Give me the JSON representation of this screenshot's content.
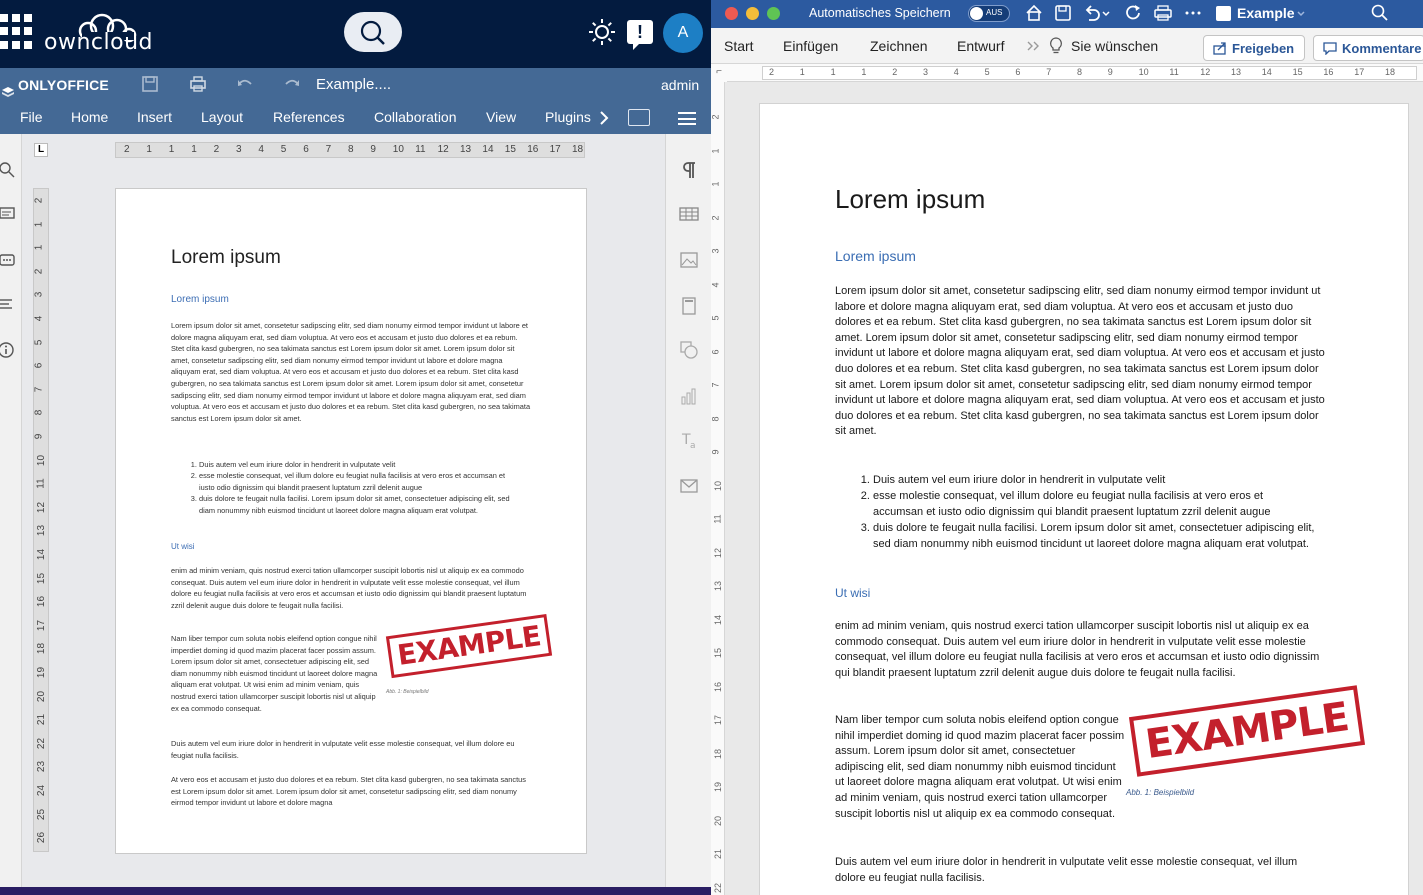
{
  "owncloud": {
    "logo_text": "owncloud",
    "avatar_initial": "A"
  },
  "onlyoffice": {
    "brand": "ONLYOFFICE",
    "doc_title": "Example....",
    "user": "admin",
    "menu": [
      "File",
      "Home",
      "Insert",
      "Layout",
      "References",
      "Collaboration",
      "View",
      "Plugins"
    ],
    "ruler_h": [
      "2",
      "1",
      "1",
      "1",
      "2",
      "3",
      "4",
      "5",
      "6",
      "7",
      "8",
      "9",
      "10",
      "11",
      "12",
      "13",
      "14",
      "15",
      "16",
      "17",
      "18"
    ],
    "ruler_v": [
      "2",
      "1",
      "1",
      "2",
      "3",
      "4",
      "5",
      "6",
      "7",
      "8",
      "9",
      "10",
      "11",
      "12",
      "13",
      "14",
      "15",
      "16",
      "17",
      "18",
      "19",
      "20",
      "21",
      "22",
      "23",
      "24",
      "25",
      "26"
    ],
    "ruler_corner": "L",
    "caption": "Abb. 1: Beispielbild"
  },
  "word": {
    "autosave_label": "Automatisches Speichern",
    "autosave_state": "AUS",
    "doc_name": "Example",
    "tabs": [
      "Start",
      "Einfügen",
      "Zeichnen",
      "Entwurf"
    ],
    "tell_me": "Sie wünschen",
    "share_label": "Freigeben",
    "comments_label": "Kommentare",
    "ruler_h": [
      "2",
      "1",
      "1",
      "1",
      "2",
      "3",
      "4",
      "5",
      "6",
      "7",
      "8",
      "9",
      "10",
      "11",
      "12",
      "13",
      "14",
      "15",
      "16",
      "17",
      "18"
    ],
    "ruler_v": [
      "2",
      "1",
      "1",
      "2",
      "3",
      "4",
      "5",
      "6",
      "7",
      "8",
      "9",
      "10",
      "11",
      "12",
      "13",
      "14",
      "15",
      "16",
      "17",
      "18",
      "19",
      "20",
      "21",
      "22",
      "23"
    ],
    "caption": "Abb. 1: Beispielbild"
  },
  "document": {
    "title": "Lorem ipsum",
    "heading1": "Lorem ipsum",
    "para1": "Lorem ipsum dolor sit amet, consetetur sadipscing elitr, sed diam nonumy eirmod tempor invidunt ut labore et dolore magna aliquyam erat, sed diam voluptua. At vero eos et accusam et justo duo dolores et ea rebum. Stet clita kasd gubergren, no sea takimata sanctus est Lorem ipsum dolor sit amet. Lorem ipsum dolor sit amet, consetetur sadipscing elitr, sed diam nonumy eirmod tempor invidunt ut labore et dolore magna aliquyam erat, sed diam voluptua. At vero eos et accusam et justo duo dolores et ea rebum. Stet clita kasd gubergren, no sea takimata sanctus est Lorem ipsum dolor sit amet. Lorem ipsum dolor sit amet, consetetur sadipscing elitr, sed diam nonumy eirmod tempor invidunt ut labore et dolore magna aliquyam erat, sed diam voluptua. At vero eos et accusam et justo duo dolores et ea rebum. Stet clita kasd gubergren, no sea takimata sanctus est Lorem ipsum dolor sit amet.",
    "list": [
      "Duis autem vel eum iriure dolor in hendrerit in vulputate velit",
      "esse molestie consequat, vel illum dolore eu feugiat nulla facilisis at vero eros et accumsan et iusto odio dignissim qui blandit praesent luptatum zzril delenit augue",
      "duis dolore te feugait nulla facilisi. Lorem ipsum dolor sit amet, consectetuer adipiscing elit, sed diam nonummy nibh euismod tincidunt ut laoreet dolore magna aliquam erat volutpat."
    ],
    "heading2": "Ut wisi",
    "para2": "enim ad minim veniam, quis nostrud exerci tation ullamcorper suscipit lobortis nisl ut aliquip ex ea commodo consequat. Duis autem vel eum iriure dolor in hendrerit in vulputate velit esse molestie consequat, vel illum dolore eu feugiat nulla facilisis at vero eros et accumsan et iusto odio dignissim qui blandit praesent luptatum zzril delenit augue duis dolore te feugait nulla facilisi.",
    "para3": "Nam liber tempor cum soluta nobis eleifend option congue nihil imperdiet doming id quod mazim placerat facer possim assum. Lorem ipsum dolor sit amet, consectetuer adipiscing elit, sed diam nonummy nibh euismod tincidunt ut laoreet dolore magna aliquam erat volutpat. Ut wisi enim ad minim veniam, quis nostrud exerci tation ullamcorper suscipit lobortis nisl ut aliquip ex ea commodo consequat.",
    "para4": "Duis autem vel eum iriure dolor in hendrerit in vulputate velit esse molestie consequat, vel illum dolore eu feugiat nulla facilisis.",
    "para5": "At vero eos et accusam et justo duo dolores et ea rebum. Stet clita kasd gubergren, no sea takimata sanctus est Lorem ipsum dolor sit amet. Lorem ipsum dolor sit amet, consetetur sadipscing elitr, sed diam nonumy eirmod tempor invidunt ut labore et dolore magna",
    "stamp_text": "EXAMPLE"
  },
  "colors": {
    "owncloud_header": "#031b3f",
    "onlyoffice_toolbar": "#446995",
    "word_titlebar": "#2c5aa0",
    "heading_blue": "#3a6db3",
    "stamp_red": "#c3202c"
  },
  "icons": [
    "app-grid-icon",
    "owncloud-logo-icon",
    "search-icon",
    "sun-icon",
    "notification-icon",
    "save-icon",
    "print-icon",
    "undo-icon",
    "redo-icon",
    "chevron-right-icon",
    "open-location-icon",
    "hamburger-icon",
    "paragraph-icon",
    "table-icon",
    "image-icon",
    "header-footer-icon",
    "shape-icon",
    "chart-icon",
    "text-art-icon",
    "mail-merge-icon",
    "comments-icon",
    "chat-icon",
    "navigation-icon",
    "info-icon",
    "home-icon",
    "redo-arrow-icon",
    "lightbulb-icon",
    "share-icon"
  ]
}
